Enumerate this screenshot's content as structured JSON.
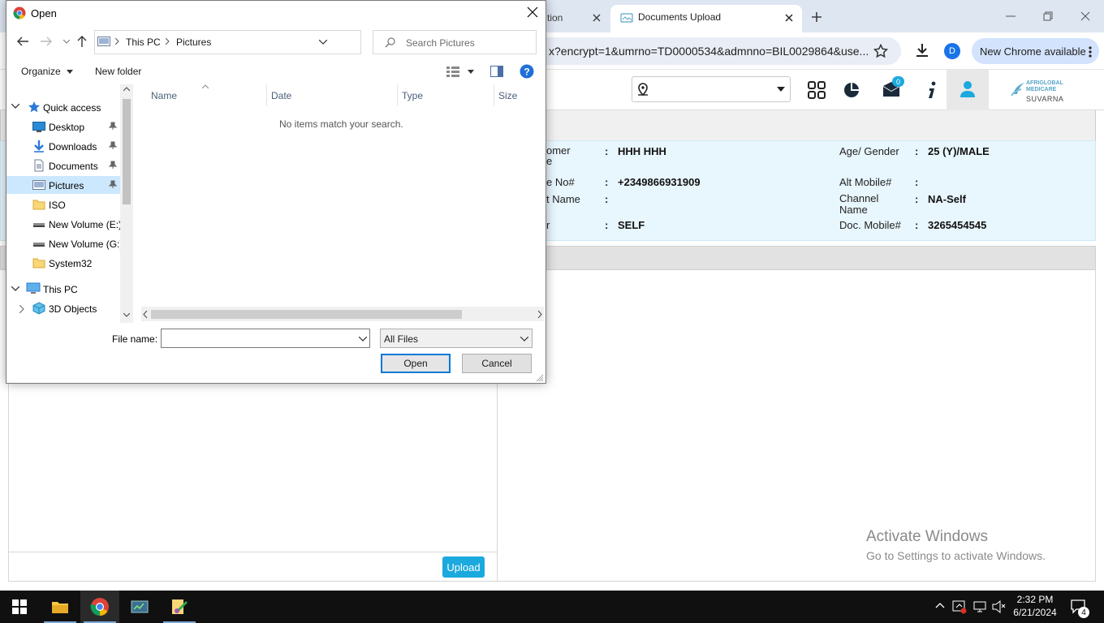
{
  "browser": {
    "tabs": [
      {
        "title": "tion"
      },
      {
        "title": "Documents Upload"
      }
    ],
    "url": "x?encrypt=1&umrno=TD0000534&admnno=BIL0029864&use...",
    "profile_initial": "D",
    "update_label": "New Chrome available"
  },
  "page": {
    "brand": {
      "top_text": "AFRIGLOBAL\nMEDICARE",
      "name": "SUVARNA"
    },
    "patient": {
      "left": [
        {
          "label": "omer\ne",
          "value": "HHH HHH"
        },
        {
          "label": "e No#",
          "value": "+2349866931909"
        },
        {
          "label": "t Name",
          "value": ""
        },
        {
          "label": "r",
          "value": "SELF"
        }
      ],
      "right": [
        {
          "label": "Age/ Gender",
          "value": "25 (Y)/MALE"
        },
        {
          "label": "Alt Mobile#",
          "value": ""
        },
        {
          "label": "Channel\nName",
          "value": "NA-Self"
        },
        {
          "label": "Doc. Mobile#",
          "value": "3265454545"
        }
      ],
      "separator": ":"
    },
    "upload_label": "Upload",
    "notification_count": "0"
  },
  "dialog": {
    "title": "Open",
    "breadcrumb": [
      "This PC",
      "Pictures"
    ],
    "search_placeholder": "Search Pictures",
    "organize_label": "Organize",
    "new_folder_label": "New folder",
    "tree": [
      {
        "label": "Quick access"
      },
      {
        "label": "Desktop"
      },
      {
        "label": "Downloads"
      },
      {
        "label": "Documents"
      },
      {
        "label": "Pictures"
      },
      {
        "label": "ISO"
      },
      {
        "label": "New Volume (E:)"
      },
      {
        "label": "New Volume (G:)"
      },
      {
        "label": "System32"
      },
      {
        "label": "This PC"
      },
      {
        "label": "3D Objects"
      }
    ],
    "columns": [
      "Name",
      "Date",
      "Type",
      "Size"
    ],
    "empty_message": "No items match your search.",
    "file_name_label": "File name:",
    "file_name_value": "",
    "file_type": "All Files",
    "open_label": "Open",
    "cancel_label": "Cancel"
  },
  "watermark": {
    "title": "Activate Windows",
    "subtitle": "Go to Settings to activate Windows."
  },
  "taskbar": {
    "time": "2:32 PM",
    "date": "6/21/2024",
    "notification_count": "4"
  },
  "colors": {
    "accent": "#1ba9de",
    "chrome_tabstrip": "#dee6f2",
    "patient_panel": "#e8f6fd",
    "dialog_focus": "#0078d7"
  }
}
